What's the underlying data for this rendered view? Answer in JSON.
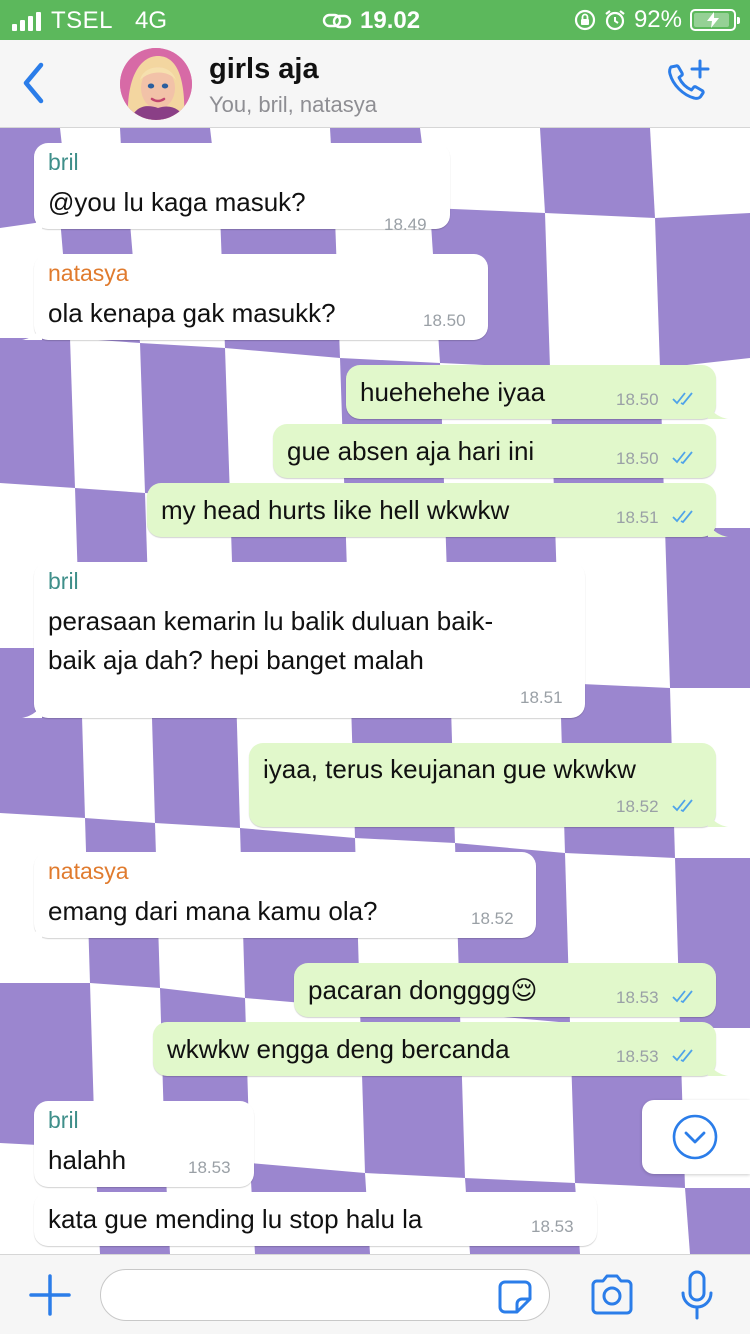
{
  "status": {
    "carrier": "TSEL",
    "network": "4G",
    "time": "19.02",
    "battery": "92%",
    "battery_level": 0.92
  },
  "header": {
    "title": "girls aja",
    "subtitle": "You, bril, natasya",
    "back_icon": "chevron-left-icon",
    "call_icon": "phone-plus-icon"
  },
  "colors": {
    "accent": "#2b7de9",
    "status_bar": "#5cb85c",
    "bubble_out": "#e1f8cb",
    "bubble_in": "#ffffff",
    "sender_bril": "#3f8f8a",
    "sender_natasya": "#e07b2e",
    "read_ticks": "#4fa3e9",
    "wallpaper_purple": "#9b86cf"
  },
  "messages": [
    {
      "sender": "bril",
      "text": "@you lu kaga masuk?",
      "time": "18.49"
    },
    {
      "sender": "natasya",
      "text": "ola kenapa gak masukk?",
      "time": "18.50"
    },
    {
      "text": "huehehehe iyaa",
      "time": "18.50"
    },
    {
      "text": "gue absen aja hari ini",
      "time": "18.50"
    },
    {
      "text": "my head hurts like hell wkwkw",
      "time": "18.51"
    },
    {
      "sender": "bril",
      "text_line1": "perasaan kemarin lu balik duluan baik-",
      "text_line2": "baik aja dah? hepi banget malah",
      "time": "18.51"
    },
    {
      "text": "iyaa, terus keujanan gue wkwkw",
      "time": "18.52"
    },
    {
      "sender": "natasya",
      "text": "emang dari mana kamu ola?",
      "time": "18.52"
    },
    {
      "text": "pacaran dongggg😌",
      "time": "18.53"
    },
    {
      "text": "wkwkw engga deng bercanda",
      "time": "18.53"
    },
    {
      "sender": "bril",
      "text": "halahh",
      "time": "18.53"
    },
    {
      "text": "kata gue mending lu stop halu la",
      "time": "18.53"
    }
  ],
  "composer": {
    "placeholder": "",
    "icons": [
      "plus-icon",
      "sticker-icon",
      "camera-icon",
      "microphone-icon"
    ]
  }
}
